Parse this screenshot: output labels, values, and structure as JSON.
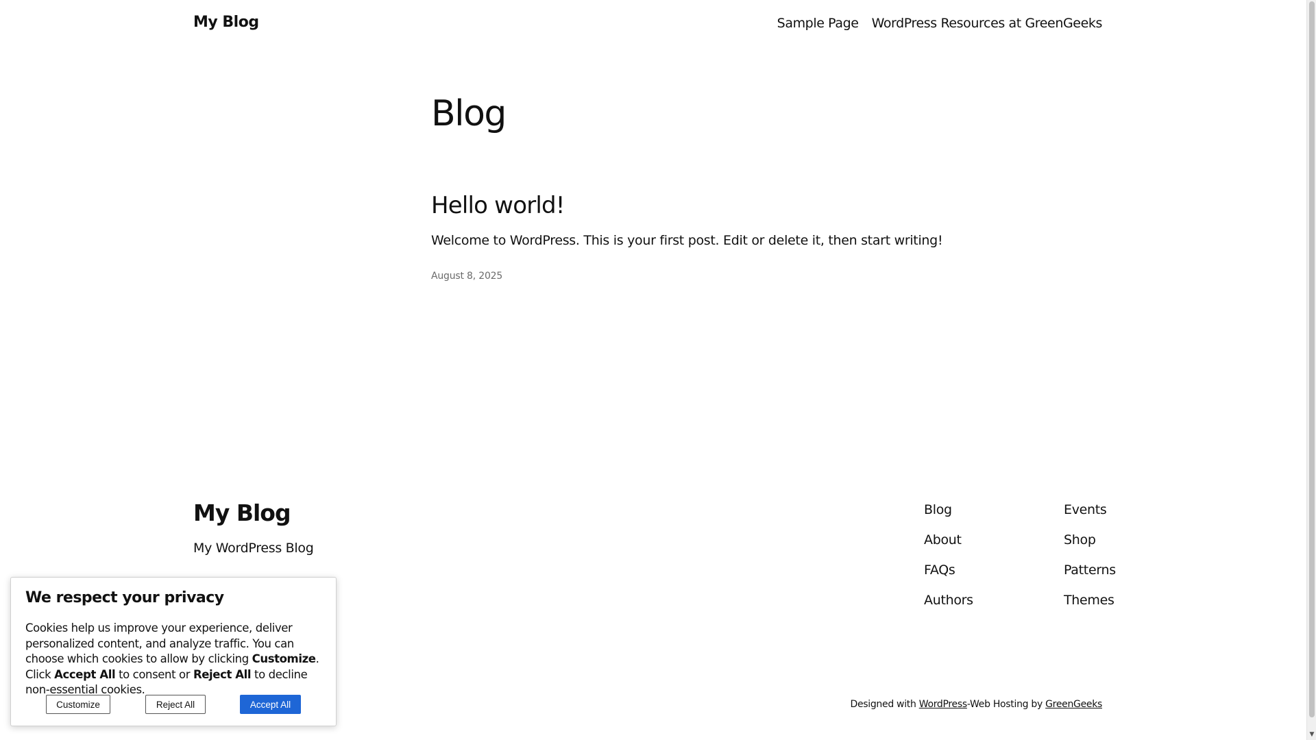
{
  "header": {
    "site_title": "My Blog",
    "nav": [
      "Sample Page",
      "WordPress Resources at GreenGeeks"
    ]
  },
  "main": {
    "heading": "Blog",
    "post": {
      "title": "Hello world!",
      "excerpt": "Welcome to WordPress. This is your first post. Edit or delete it, then start writing!",
      "date": "August 8, 2025"
    }
  },
  "footer": {
    "title": "My Blog",
    "tagline": "My WordPress Blog",
    "col1": [
      "Blog",
      "About",
      "FAQs",
      "Authors"
    ],
    "col2": [
      "Events",
      "Shop",
      "Patterns",
      "Themes"
    ],
    "credits": {
      "prefix": "Designed with ",
      "wordpress": "WordPress",
      "middle": "-Web Hosting by ",
      "greengeeks": "GreenGeeks"
    }
  },
  "cookie_banner": {
    "title": "We respect your privacy",
    "text_1": "Cookies help us improve your experience, deliver personalized content, and analyze traffic. You can choose which cookies to allow by clicking ",
    "text_customize": "Customize",
    "text_2": ". Click ",
    "text_accept": "Accept All",
    "text_3": " to consent or ",
    "text_reject": "Reject All",
    "text_4": " to decline non-essential cookies.",
    "buttons": {
      "customize": "Customize",
      "reject": "Reject All",
      "accept": "Accept All"
    },
    "accent_color": "#1e66d6"
  }
}
